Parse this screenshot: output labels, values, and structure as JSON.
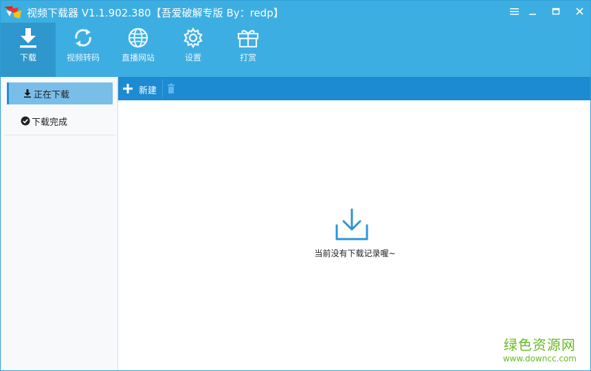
{
  "window": {
    "title": "视频下载器 V1.1.902.380【吾爱破解专版  By：redp】"
  },
  "nav": {
    "items": [
      {
        "label": "下载",
        "icon": "download-icon"
      },
      {
        "label": "视频转码",
        "icon": "refresh-icon"
      },
      {
        "label": "直播网站",
        "icon": "globe-icon"
      },
      {
        "label": "设置",
        "icon": "gear-icon"
      },
      {
        "label": "打赏",
        "icon": "gift-icon"
      }
    ],
    "active_index": 0
  },
  "sidebar": {
    "items": [
      {
        "label": "正在下载",
        "icon": "download-small-icon"
      },
      {
        "label": "下载完成",
        "icon": "check-circle-icon"
      }
    ],
    "active_index": 0
  },
  "toolbar": {
    "new_label": "新建"
  },
  "main": {
    "empty_text": "当前没有下载记录喔~"
  },
  "watermark": {
    "title": "绿色资源网",
    "url": "www.downcc.com"
  },
  "colors": {
    "header": "#3daee2",
    "active_nav": "#2e97cc",
    "toolbar": "#1c8bd2",
    "accent": "#1f8fd0",
    "watermark": "#66bb22"
  }
}
